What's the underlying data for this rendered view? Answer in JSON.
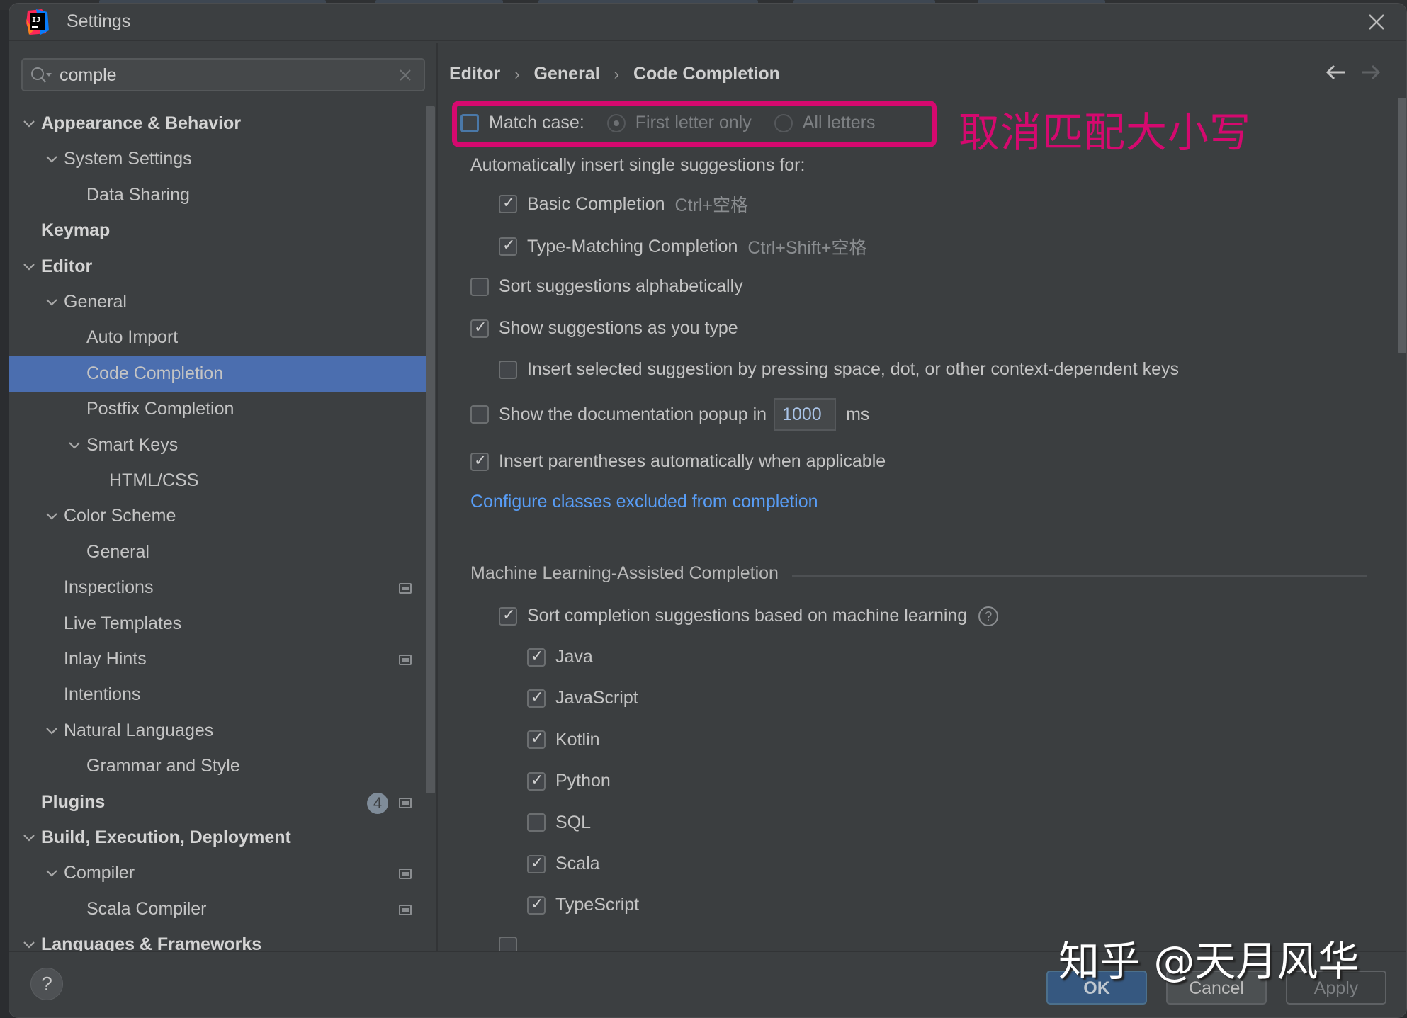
{
  "window": {
    "title": "Settings",
    "close_label": "Close"
  },
  "search": {
    "value": "comple",
    "placeholder": ""
  },
  "tree": [
    {
      "label": "Appearance & Behavior",
      "level": 0,
      "bold": true,
      "expanded": true
    },
    {
      "label": "System Settings",
      "level": 1,
      "bold": false,
      "expanded": true
    },
    {
      "label": "Data Sharing",
      "level": 2,
      "bold": false
    },
    {
      "label": "Keymap",
      "level": 0,
      "bold": true
    },
    {
      "label": "Editor",
      "level": 0,
      "bold": true,
      "expanded": true
    },
    {
      "label": "General",
      "level": 1,
      "bold": false,
      "expanded": true
    },
    {
      "label": "Auto Import",
      "level": 2,
      "bold": false
    },
    {
      "label": "Code Completion",
      "level": 2,
      "bold": false,
      "selected": true
    },
    {
      "label": "Postfix Completion",
      "level": 2,
      "bold": false
    },
    {
      "label": "Smart Keys",
      "level": 2,
      "bold": false,
      "expanded": true
    },
    {
      "label": "HTML/CSS",
      "level": 3,
      "bold": false
    },
    {
      "label": "Color Scheme",
      "level": 1,
      "bold": false,
      "expanded": true
    },
    {
      "label": "General",
      "level": 2,
      "bold": false
    },
    {
      "label": "Inspections",
      "level": 1,
      "bold": false,
      "project_icon": true
    },
    {
      "label": "Live Templates",
      "level": 1,
      "bold": false
    },
    {
      "label": "Inlay Hints",
      "level": 1,
      "bold": false,
      "project_icon": true
    },
    {
      "label": "Intentions",
      "level": 1,
      "bold": false
    },
    {
      "label": "Natural Languages",
      "level": 1,
      "bold": false,
      "expanded": true
    },
    {
      "label": "Grammar and Style",
      "level": 2,
      "bold": false
    },
    {
      "label": "Plugins",
      "level": 0,
      "bold": true,
      "badge": "4",
      "project_icon": true
    },
    {
      "label": "Build, Execution, Deployment",
      "level": 0,
      "bold": true,
      "expanded": true
    },
    {
      "label": "Compiler",
      "level": 1,
      "bold": false,
      "expanded": true,
      "project_icon": true
    },
    {
      "label": "Scala Compiler",
      "level": 2,
      "bold": false,
      "project_icon": true
    },
    {
      "label": "Languages & Frameworks",
      "level": 0,
      "bold": true,
      "expanded": true
    }
  ],
  "breadcrumb": [
    "Editor",
    "General",
    "Code Completion"
  ],
  "breadcrumb_separator": "›",
  "annotation": "取消匹配大小写",
  "settings": {
    "match_case": {
      "label": "Match case:",
      "checked": false
    },
    "match_case_options": [
      {
        "label": "First letter only",
        "selected": true
      },
      {
        "label": "All letters",
        "selected": false
      }
    ],
    "auto_insert_heading": "Automatically insert single suggestions for:",
    "basic_completion": {
      "label": "Basic Completion",
      "shortcut": "Ctrl+空格",
      "checked": true
    },
    "type_matching": {
      "label": "Type-Matching Completion",
      "shortcut": "Ctrl+Shift+空格",
      "checked": true
    },
    "sort_alpha": {
      "label": "Sort suggestions alphabetically",
      "checked": false
    },
    "show_as_type": {
      "label": "Show suggestions as you type",
      "checked": true
    },
    "insert_selected": {
      "label": "Insert selected suggestion by pressing space, dot, or other context-dependent keys",
      "checked": false
    },
    "doc_popup": {
      "label": "Show the documentation popup in",
      "value": "1000",
      "unit": "ms",
      "checked": false
    },
    "insert_parens": {
      "label": "Insert parentheses automatically when applicable",
      "checked": true
    },
    "configure_link": "Configure classes excluded from completion",
    "ml_section_title": "Machine Learning-Assisted Completion",
    "ml_sort": {
      "label": "Sort completion suggestions based on machine learning",
      "checked": true,
      "help": "?"
    },
    "ml_languages": [
      {
        "label": "Java",
        "checked": true
      },
      {
        "label": "JavaScript",
        "checked": true
      },
      {
        "label": "Kotlin",
        "checked": true
      },
      {
        "label": "Python",
        "checked": true
      },
      {
        "label": "SQL",
        "checked": false
      },
      {
        "label": "Scala",
        "checked": true
      },
      {
        "label": "TypeScript",
        "checked": true
      }
    ]
  },
  "footer": {
    "help": "?",
    "ok": "OK",
    "cancel": "Cancel",
    "apply": "Apply"
  },
  "watermark": "知乎 @天月风华",
  "colors": {
    "selection": "#4b6eaf",
    "link": "#589df6",
    "annotation": "#d5096f",
    "ok_button": "#365880"
  }
}
